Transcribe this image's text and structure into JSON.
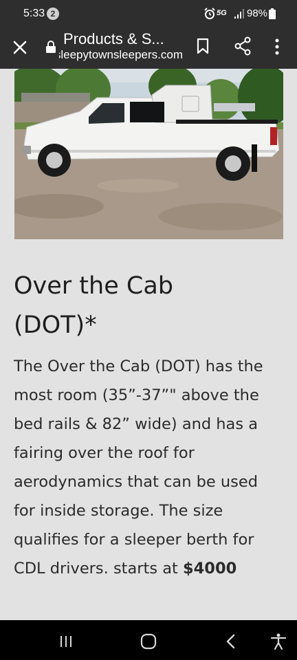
{
  "status_bar": {
    "time": "5:33",
    "notification_count": "2",
    "network": "5G",
    "battery": "98%"
  },
  "browser": {
    "page_title": "Products & S...",
    "url": "sleepytownsleepers.com",
    "icons": [
      "close-icon",
      "lock-icon",
      "bookmark-icon",
      "share-icon",
      "more-vert-icon"
    ]
  },
  "article": {
    "image_icon": "truck-photo",
    "heading_line1": "Over the Cab",
    "heading_line2": "(DOT)*",
    "body_lines": [
      "The Over the Cab (DOT) has the",
      "most room (35”-37”\" above the",
      "bed rails & 82” wide) and has a",
      "fairing over the roof for",
      "aerodynamics that can be used",
      "for inside storage. The size",
      "qualifies for a sleeper berth for"
    ],
    "last_line_prefix": "CDL drivers. starts at ",
    "price": "$4000"
  },
  "nav_bar": {
    "icons": [
      "recent-apps-icon",
      "home-icon",
      "back-icon",
      "accessibility-icon"
    ]
  },
  "colors": {
    "bar_bg": "#2e2e2e",
    "page_bg": "#e2e2e2",
    "text": "#2b2b2b",
    "nav_bg": "#000000"
  }
}
